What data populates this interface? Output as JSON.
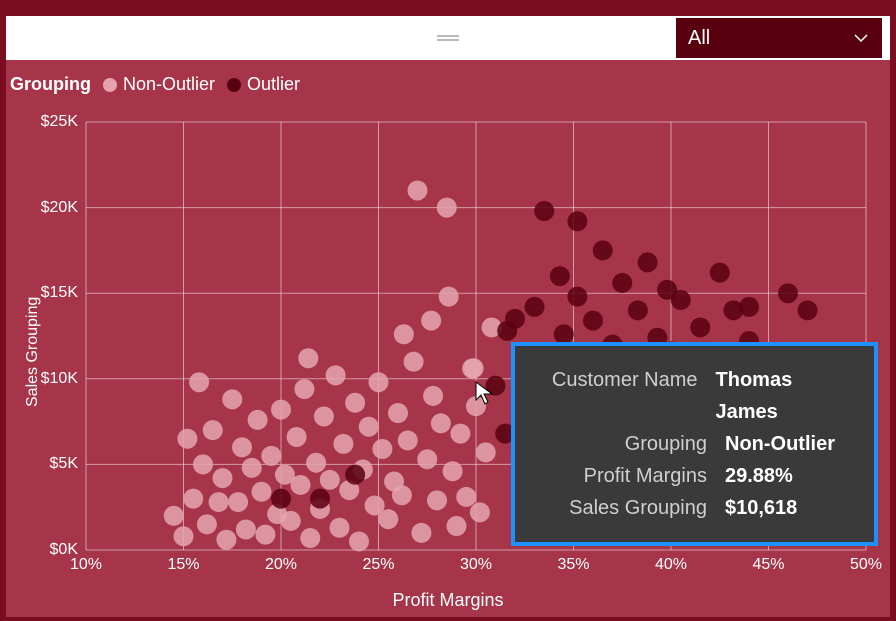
{
  "dropdown": {
    "selected": "All"
  },
  "legend": {
    "title": "Grouping",
    "items": [
      {
        "label": "Non-Outlier",
        "color": "#e4a4af"
      },
      {
        "label": "Outlier",
        "color": "#59000f"
      }
    ]
  },
  "axes": {
    "xlabel": "Profit Margins",
    "ylabel": "Sales Grouping",
    "xticks": [
      "10%",
      "15%",
      "20%",
      "25%",
      "30%",
      "35%",
      "40%",
      "45%",
      "50%"
    ],
    "yticks": [
      "$0K",
      "$5K",
      "$10K",
      "$15K",
      "$20K",
      "$25K"
    ]
  },
  "tooltip": {
    "rows": [
      {
        "key": "Customer Name",
        "val": "Thomas James"
      },
      {
        "key": "Grouping",
        "val": "Non-Outlier"
      },
      {
        "key": "Profit Margins",
        "val": "29.88%"
      },
      {
        "key": "Sales Grouping",
        "val": "$10,618"
      }
    ]
  },
  "chart_data": {
    "type": "scatter",
    "xlabel": "Profit Margins",
    "ylabel": "Sales Grouping",
    "xlim": [
      10,
      50
    ],
    "ylim": [
      0,
      25000
    ],
    "legend_title": "Grouping",
    "series": [
      {
        "name": "Non-Outlier",
        "color": "#e4a4af",
        "points": [
          {
            "x": 14.5,
            "y": 2000
          },
          {
            "x": 15.0,
            "y": 800
          },
          {
            "x": 15.2,
            "y": 6500
          },
          {
            "x": 15.5,
            "y": 3000
          },
          {
            "x": 15.8,
            "y": 9800
          },
          {
            "x": 16.0,
            "y": 5000
          },
          {
            "x": 16.2,
            "y": 1500
          },
          {
            "x": 16.5,
            "y": 7000
          },
          {
            "x": 16.8,
            "y": 2800
          },
          {
            "x": 17.0,
            "y": 4200
          },
          {
            "x": 17.2,
            "y": 600
          },
          {
            "x": 17.5,
            "y": 8800
          },
          {
            "x": 17.8,
            "y": 2800
          },
          {
            "x": 18.0,
            "y": 6000
          },
          {
            "x": 18.2,
            "y": 1200
          },
          {
            "x": 18.5,
            "y": 4800
          },
          {
            "x": 18.8,
            "y": 7600
          },
          {
            "x": 19.0,
            "y": 3400
          },
          {
            "x": 19.2,
            "y": 900
          },
          {
            "x": 19.5,
            "y": 5500
          },
          {
            "x": 19.8,
            "y": 2100
          },
          {
            "x": 20.0,
            "y": 8200
          },
          {
            "x": 20.2,
            "y": 4400
          },
          {
            "x": 20.5,
            "y": 1700
          },
          {
            "x": 20.8,
            "y": 6600
          },
          {
            "x": 21.0,
            "y": 3800
          },
          {
            "x": 21.2,
            "y": 9400
          },
          {
            "x": 21.4,
            "y": 11200
          },
          {
            "x": 21.5,
            "y": 700
          },
          {
            "x": 21.8,
            "y": 5100
          },
          {
            "x": 22.0,
            "y": 2400
          },
          {
            "x": 22.2,
            "y": 7800
          },
          {
            "x": 22.5,
            "y": 4100
          },
          {
            "x": 22.8,
            "y": 10200
          },
          {
            "x": 23.0,
            "y": 1300
          },
          {
            "x": 23.2,
            "y": 6200
          },
          {
            "x": 23.5,
            "y": 3500
          },
          {
            "x": 23.8,
            "y": 8600
          },
          {
            "x": 24.0,
            "y": 500
          },
          {
            "x": 24.2,
            "y": 4700
          },
          {
            "x": 24.5,
            "y": 7200
          },
          {
            "x": 24.8,
            "y": 2600
          },
          {
            "x": 25.0,
            "y": 9800
          },
          {
            "x": 25.2,
            "y": 5900
          },
          {
            "x": 25.5,
            "y": 1800
          },
          {
            "x": 25.8,
            "y": 4000
          },
          {
            "x": 26.0,
            "y": 8000
          },
          {
            "x": 26.2,
            "y": 3200
          },
          {
            "x": 26.3,
            "y": 12600
          },
          {
            "x": 26.5,
            "y": 6400
          },
          {
            "x": 26.8,
            "y": 11000
          },
          {
            "x": 27.0,
            "y": 21000
          },
          {
            "x": 27.2,
            "y": 1000
          },
          {
            "x": 27.5,
            "y": 5300
          },
          {
            "x": 27.7,
            "y": 13400
          },
          {
            "x": 27.8,
            "y": 9000
          },
          {
            "x": 28.0,
            "y": 2900
          },
          {
            "x": 28.2,
            "y": 7400
          },
          {
            "x": 28.5,
            "y": 20000
          },
          {
            "x": 28.6,
            "y": 14800
          },
          {
            "x": 28.8,
            "y": 4600
          },
          {
            "x": 29.0,
            "y": 1400
          },
          {
            "x": 29.2,
            "y": 6800
          },
          {
            "x": 29.5,
            "y": 3100
          },
          {
            "x": 29.8,
            "y": 10600
          },
          {
            "x": 29.88,
            "y": 10618
          },
          {
            "x": 30.0,
            "y": 8400
          },
          {
            "x": 30.2,
            "y": 2200
          },
          {
            "x": 30.5,
            "y": 5700
          },
          {
            "x": 30.8,
            "y": 13000
          }
        ]
      },
      {
        "name": "Outlier",
        "color": "#59000f",
        "points": [
          {
            "x": 20.0,
            "y": 3000
          },
          {
            "x": 22.0,
            "y": 3000
          },
          {
            "x": 23.8,
            "y": 4400
          },
          {
            "x": 31.0,
            "y": 9600
          },
          {
            "x": 31.5,
            "y": 6800
          },
          {
            "x": 31.6,
            "y": 12800
          },
          {
            "x": 32.0,
            "y": 13500
          },
          {
            "x": 32.3,
            "y": 8200
          },
          {
            "x": 32.5,
            "y": 11000
          },
          {
            "x": 32.8,
            "y": 4800
          },
          {
            "x": 33.0,
            "y": 14200
          },
          {
            "x": 33.3,
            "y": 7600
          },
          {
            "x": 33.5,
            "y": 19800
          },
          {
            "x": 33.8,
            "y": 10400
          },
          {
            "x": 34.0,
            "y": 6200
          },
          {
            "x": 34.3,
            "y": 16000
          },
          {
            "x": 34.5,
            "y": 12600
          },
          {
            "x": 34.8,
            "y": 8800
          },
          {
            "x": 35.0,
            "y": 5400
          },
          {
            "x": 35.2,
            "y": 14800
          },
          {
            "x": 35.2,
            "y": 19200
          },
          {
            "x": 35.5,
            "y": 11200
          },
          {
            "x": 35.8,
            "y": 7200
          },
          {
            "x": 36.0,
            "y": 13400
          },
          {
            "x": 36.3,
            "y": 9400
          },
          {
            "x": 36.5,
            "y": 17500
          },
          {
            "x": 36.8,
            "y": 6000
          },
          {
            "x": 37.0,
            "y": 12000
          },
          {
            "x": 37.3,
            "y": 8600
          },
          {
            "x": 37.5,
            "y": 15600
          },
          {
            "x": 37.8,
            "y": 4400
          },
          {
            "x": 38.0,
            "y": 10800
          },
          {
            "x": 38.3,
            "y": 14000
          },
          {
            "x": 38.5,
            "y": 7000
          },
          {
            "x": 38.8,
            "y": 16800
          },
          {
            "x": 39.0,
            "y": 9000
          },
          {
            "x": 39.3,
            "y": 12400
          },
          {
            "x": 39.5,
            "y": 5600
          },
          {
            "x": 39.8,
            "y": 15200
          },
          {
            "x": 40.0,
            "y": 11600
          },
          {
            "x": 40.3,
            "y": 8000
          },
          {
            "x": 40.5,
            "y": 14600
          },
          {
            "x": 41.0,
            "y": 6400
          },
          {
            "x": 41.5,
            "y": 13000
          },
          {
            "x": 42.0,
            "y": 9800
          },
          {
            "x": 42.5,
            "y": 16200
          },
          {
            "x": 43.0,
            "y": 7800
          },
          {
            "x": 43.2,
            "y": 14000
          },
          {
            "x": 44.0,
            "y": 12200
          },
          {
            "x": 44.0,
            "y": 14200
          },
          {
            "x": 45.0,
            "y": 9200
          },
          {
            "x": 46.0,
            "y": 15000
          },
          {
            "x": 47.0,
            "y": 14000
          },
          {
            "x": 48.0,
            "y": 11400
          }
        ]
      }
    ]
  }
}
